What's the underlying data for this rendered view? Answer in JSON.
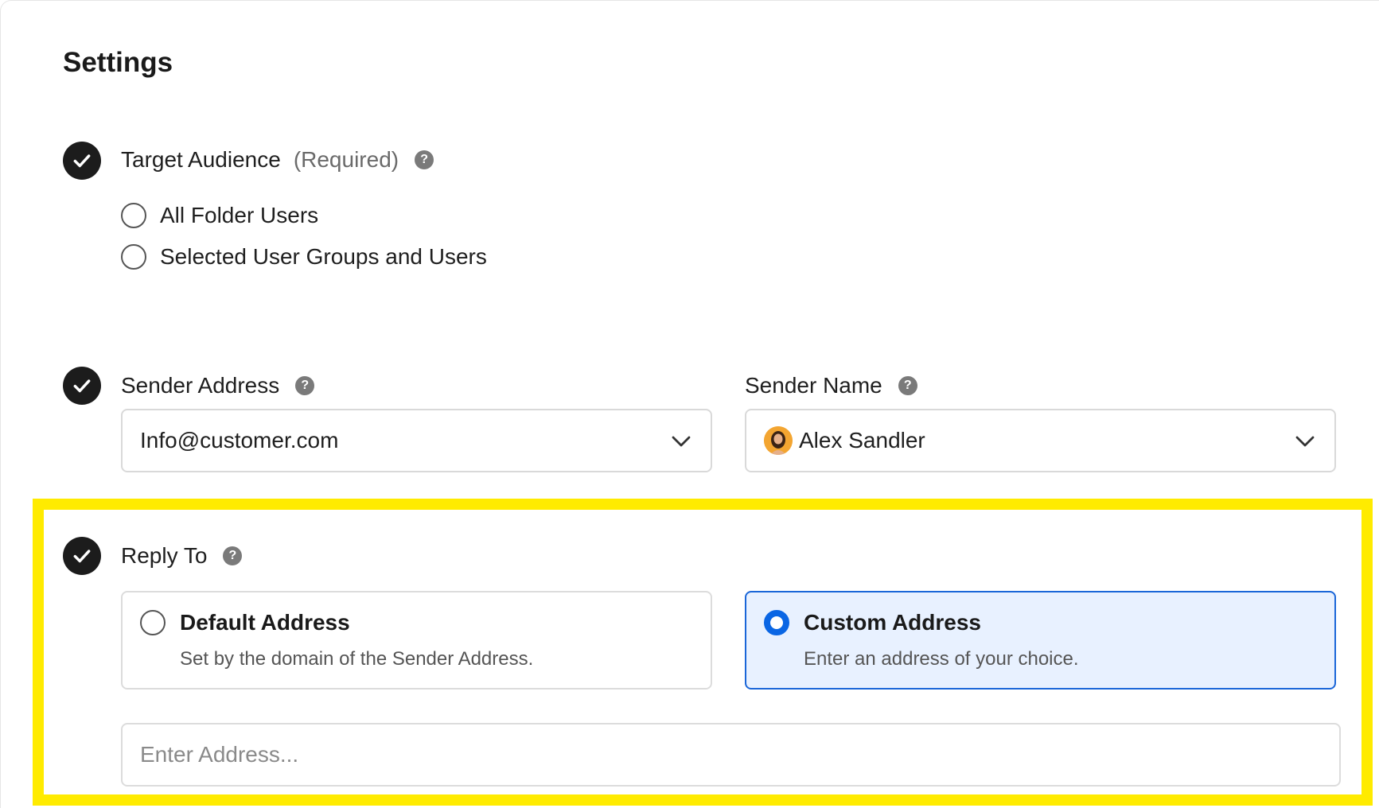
{
  "page": {
    "title": "Settings"
  },
  "target_audience": {
    "label": "Target Audience",
    "required": "(Required)",
    "options": [
      "All Folder Users",
      "Selected User Groups and Users"
    ]
  },
  "sender_address": {
    "label": "Sender Address",
    "value": "Info@customer.com"
  },
  "sender_name": {
    "label": "Sender Name",
    "value": "Alex Sandler"
  },
  "reply_to": {
    "label": "Reply To",
    "options": [
      {
        "title": "Default Address",
        "description": "Set by the domain of the Sender Address.",
        "selected": false
      },
      {
        "title": "Custom Address",
        "description": "Enter an address of your choice.",
        "selected": true
      }
    ],
    "address_placeholder": "Enter Address...",
    "address_value": ""
  },
  "help_glyph": "?",
  "colors": {
    "accent": "#0a66e4",
    "highlight": "#ffeb00",
    "check_bg": "#1c1c1c",
    "selected_card_bg": "#e8f1ff"
  },
  "icons": {
    "check": "checkmark-circle-icon",
    "help": "question-circle-icon",
    "dropdown": "chevron-down-icon",
    "avatar": "user-avatar"
  }
}
